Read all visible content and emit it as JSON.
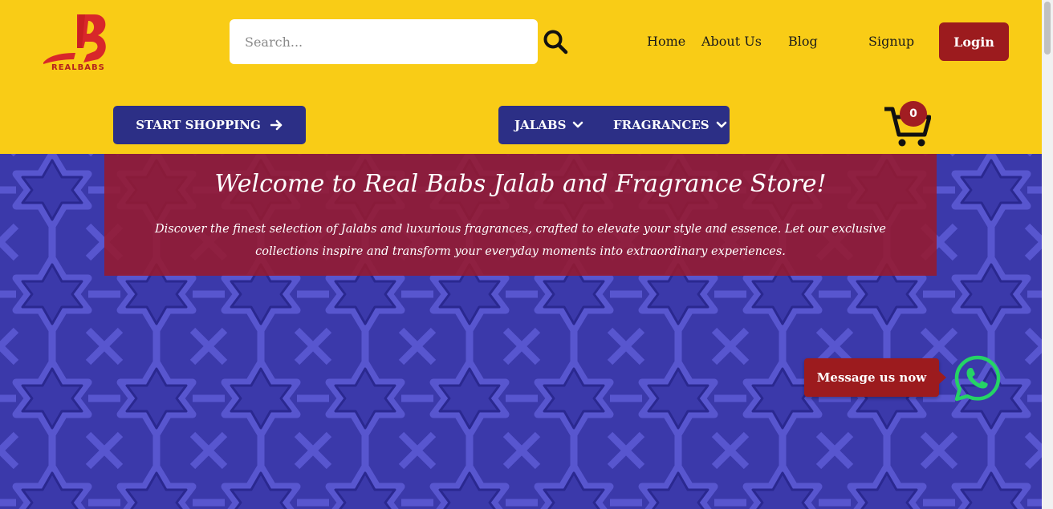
{
  "brand": {
    "name": "REALBABS",
    "colors": {
      "primary": "#f9cc16",
      "navy": "#2c2f86",
      "maroon": "#9c1b1e",
      "hero": "#3b39aa",
      "whatsapp": "#25d366"
    }
  },
  "search": {
    "placeholder": "Search...",
    "icon": "search-icon"
  },
  "nav": {
    "home": "Home",
    "about": "About Us",
    "blog": "Blog",
    "signup": "Signup",
    "login": "Login"
  },
  "actions": {
    "start_shopping": "START SHOPPING",
    "start_shopping_icon": "arrow-right-icon"
  },
  "categories": [
    {
      "label": "JALABS",
      "icon": "chevron-down-icon"
    },
    {
      "label": "FRAGRANCES",
      "icon": "chevron-down-icon"
    }
  ],
  "cart": {
    "count": "0",
    "icon": "cart-icon"
  },
  "hero": {
    "title": "Welcome to Real Babs Jalab and Fragrance Store!",
    "text": "Discover the finest selection of Jalabs and luxurious fragrances, crafted to elevate your style and essence. Let our exclusive collections inspire and transform your everyday moments into extraordinary experiences."
  },
  "chat": {
    "label": "Message us now",
    "icon": "whatsapp-icon"
  }
}
